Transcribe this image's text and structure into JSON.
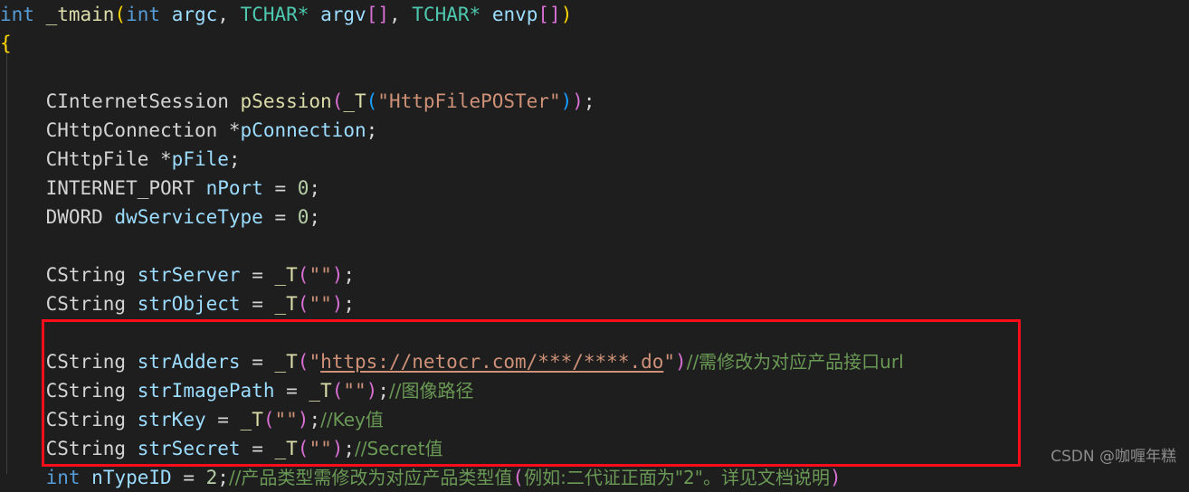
{
  "editor": {
    "background_color": "#1e1e1e",
    "default_text_color": "#d4d4d4",
    "language": "cpp",
    "font_size_px": 21,
    "line_height_px": 32
  },
  "highlight_box": {
    "color": "#fc0d1b",
    "covers_lines": [
      "CString strAdders = _T(\"https://netocr.com/***/****.do\")//需修改为对应产品接口url",
      "CString strImagePath = _T(\"\");//图像路径",
      "CString strKey = _T(\"\");//Key值",
      "CString strSecret = _T(\"\");//Secret值",
      "int nTypeID = 2;//产品类型需修改为对应产品类型值(例如:二代证正面为\"2\"。详见文档说明)"
    ]
  },
  "watermark": {
    "text": "CSDN @咖喱年糕",
    "color": "#8c8c8c"
  },
  "code_lines": [
    {
      "index": 1,
      "text": "int _tmain(int argc, TCHAR* argv[], TCHAR* envp[])",
      "tokens": [
        {
          "t": "int",
          "c": "c-keyword"
        },
        {
          "t": " ",
          "c": "c-plain"
        },
        {
          "t": "_tmain",
          "c": "c-func"
        },
        {
          "t": "(",
          "c": "c-brk-gold"
        },
        {
          "t": "int",
          "c": "c-keyword"
        },
        {
          "t": " ",
          "c": "c-plain"
        },
        {
          "t": "argc",
          "c": "c-var"
        },
        {
          "t": ", ",
          "c": "c-punc"
        },
        {
          "t": "TCHAR",
          "c": "c-type"
        },
        {
          "t": "*",
          "c": "c-type"
        },
        {
          "t": " ",
          "c": "c-plain"
        },
        {
          "t": "argv",
          "c": "c-var"
        },
        {
          "t": "[]",
          "c": "c-brk-pink"
        },
        {
          "t": ", ",
          "c": "c-punc"
        },
        {
          "t": "TCHAR",
          "c": "c-type"
        },
        {
          "t": "*",
          "c": "c-type"
        },
        {
          "t": " ",
          "c": "c-plain"
        },
        {
          "t": "envp",
          "c": "c-var"
        },
        {
          "t": "[]",
          "c": "c-brk-pink"
        },
        {
          "t": ")",
          "c": "c-brk-gold"
        }
      ]
    },
    {
      "index": 2,
      "text": "{",
      "tokens": [
        {
          "t": "{",
          "c": "c-brk-gold"
        }
      ]
    },
    {
      "index": 3,
      "text": "",
      "tokens": []
    },
    {
      "index": 4,
      "text": "    CInternetSession pSession(_T(\"HttpFilePOSTer\"));",
      "tokens": [
        {
          "t": "    ",
          "c": "c-plain"
        },
        {
          "t": "CInternetSession",
          "c": "c-plain"
        },
        {
          "t": " ",
          "c": "c-plain"
        },
        {
          "t": "pSession",
          "c": "c-func"
        },
        {
          "t": "(",
          "c": "c-brk-pink"
        },
        {
          "t": "_T",
          "c": "c-func"
        },
        {
          "t": "(",
          "c": "c-brk-blue"
        },
        {
          "t": "\"HttpFilePOSTer\"",
          "c": "c-string"
        },
        {
          "t": ")",
          "c": "c-brk-blue"
        },
        {
          "t": ")",
          "c": "c-brk-pink"
        },
        {
          "t": ";",
          "c": "c-punc"
        }
      ]
    },
    {
      "index": 5,
      "text": "    CHttpConnection *pConnection;",
      "tokens": [
        {
          "t": "    ",
          "c": "c-plain"
        },
        {
          "t": "CHttpConnection",
          "c": "c-plain"
        },
        {
          "t": " *",
          "c": "c-plain"
        },
        {
          "t": "pConnection",
          "c": "c-var"
        },
        {
          "t": ";",
          "c": "c-punc"
        }
      ]
    },
    {
      "index": 6,
      "text": "    CHttpFile *pFile;",
      "tokens": [
        {
          "t": "    ",
          "c": "c-plain"
        },
        {
          "t": "CHttpFile",
          "c": "c-plain"
        },
        {
          "t": " *",
          "c": "c-plain"
        },
        {
          "t": "pFile",
          "c": "c-var"
        },
        {
          "t": ";",
          "c": "c-punc"
        }
      ]
    },
    {
      "index": 7,
      "text": "    INTERNET_PORT nPort = 0;",
      "tokens": [
        {
          "t": "    ",
          "c": "c-plain"
        },
        {
          "t": "INTERNET_PORT",
          "c": "c-plain"
        },
        {
          "t": " ",
          "c": "c-plain"
        },
        {
          "t": "nPort",
          "c": "c-var"
        },
        {
          "t": " = ",
          "c": "c-punc"
        },
        {
          "t": "0",
          "c": "c-number"
        },
        {
          "t": ";",
          "c": "c-punc"
        }
      ]
    },
    {
      "index": 8,
      "text": "    DWORD dwServiceType = 0;",
      "tokens": [
        {
          "t": "    ",
          "c": "c-plain"
        },
        {
          "t": "DWORD",
          "c": "c-plain"
        },
        {
          "t": " ",
          "c": "c-plain"
        },
        {
          "t": "dwServiceType",
          "c": "c-var"
        },
        {
          "t": " = ",
          "c": "c-punc"
        },
        {
          "t": "0",
          "c": "c-number"
        },
        {
          "t": ";",
          "c": "c-punc"
        }
      ]
    },
    {
      "index": 9,
      "text": "",
      "tokens": []
    },
    {
      "index": 10,
      "text": "    CString strServer = _T(\"\");",
      "tokens": [
        {
          "t": "    ",
          "c": "c-plain"
        },
        {
          "t": "CString",
          "c": "c-plain"
        },
        {
          "t": " ",
          "c": "c-plain"
        },
        {
          "t": "strServer",
          "c": "c-var"
        },
        {
          "t": " = ",
          "c": "c-punc"
        },
        {
          "t": "_T",
          "c": "c-func"
        },
        {
          "t": "(",
          "c": "c-brk-pink"
        },
        {
          "t": "\"\"",
          "c": "c-string"
        },
        {
          "t": ")",
          "c": "c-brk-pink"
        },
        {
          "t": ";",
          "c": "c-punc"
        }
      ]
    },
    {
      "index": 11,
      "text": "    CString strObject = _T(\"\");",
      "tokens": [
        {
          "t": "    ",
          "c": "c-plain"
        },
        {
          "t": "CString",
          "c": "c-plain"
        },
        {
          "t": " ",
          "c": "c-plain"
        },
        {
          "t": "strObject",
          "c": "c-var"
        },
        {
          "t": " = ",
          "c": "c-punc"
        },
        {
          "t": "_T",
          "c": "c-func"
        },
        {
          "t": "(",
          "c": "c-brk-pink"
        },
        {
          "t": "\"\"",
          "c": "c-string"
        },
        {
          "t": ")",
          "c": "c-brk-pink"
        },
        {
          "t": ";",
          "c": "c-punc"
        }
      ]
    },
    {
      "index": 12,
      "text": "",
      "tokens": []
    },
    {
      "index": 13,
      "text": "    CString strAdders = _T(\"https://netocr.com/***/****.do\")//需修改为对应产品接口url",
      "tokens": [
        {
          "t": "    ",
          "c": "c-plain"
        },
        {
          "t": "CString",
          "c": "c-plain"
        },
        {
          "t": " ",
          "c": "c-plain"
        },
        {
          "t": "strAdders",
          "c": "c-var"
        },
        {
          "t": " = ",
          "c": "c-punc"
        },
        {
          "t": "_T",
          "c": "c-func"
        },
        {
          "t": "(",
          "c": "c-brk-pink"
        },
        {
          "t": "\"",
          "c": "c-string"
        },
        {
          "t": "https://netocr.com/***/****.do",
          "c": "c-string underlined"
        },
        {
          "t": "\"",
          "c": "c-string"
        },
        {
          "t": ")",
          "c": "c-brk-pink"
        },
        {
          "t": "//需修改为对应产品接口url",
          "c": "c-comment"
        }
      ]
    },
    {
      "index": 14,
      "text": "    CString strImagePath = _T(\"\");//图像路径",
      "tokens": [
        {
          "t": "    ",
          "c": "c-plain"
        },
        {
          "t": "CString",
          "c": "c-plain"
        },
        {
          "t": " ",
          "c": "c-plain"
        },
        {
          "t": "strImagePath",
          "c": "c-var"
        },
        {
          "t": " = ",
          "c": "c-punc"
        },
        {
          "t": "_T",
          "c": "c-func"
        },
        {
          "t": "(",
          "c": "c-brk-pink"
        },
        {
          "t": "\"\"",
          "c": "c-string"
        },
        {
          "t": ")",
          "c": "c-brk-pink"
        },
        {
          "t": ";",
          "c": "c-punc"
        },
        {
          "t": "//图像路径",
          "c": "c-comment"
        }
      ]
    },
    {
      "index": 15,
      "text": "    CString strKey = _T(\"\");//Key值",
      "tokens": [
        {
          "t": "    ",
          "c": "c-plain"
        },
        {
          "t": "CString",
          "c": "c-plain"
        },
        {
          "t": " ",
          "c": "c-plain"
        },
        {
          "t": "strKey",
          "c": "c-var"
        },
        {
          "t": " = ",
          "c": "c-punc"
        },
        {
          "t": "_T",
          "c": "c-func"
        },
        {
          "t": "(",
          "c": "c-brk-pink"
        },
        {
          "t": "\"\"",
          "c": "c-string"
        },
        {
          "t": ")",
          "c": "c-brk-pink"
        },
        {
          "t": ";",
          "c": "c-punc"
        },
        {
          "t": "//Key值",
          "c": "c-comment"
        }
      ]
    },
    {
      "index": 16,
      "text": "    CString strSecret = _T(\"\");//Secret值",
      "tokens": [
        {
          "t": "    ",
          "c": "c-plain"
        },
        {
          "t": "CString",
          "c": "c-plain"
        },
        {
          "t": " ",
          "c": "c-plain"
        },
        {
          "t": "strSecret",
          "c": "c-var"
        },
        {
          "t": " = ",
          "c": "c-punc"
        },
        {
          "t": "_T",
          "c": "c-func"
        },
        {
          "t": "(",
          "c": "c-brk-pink"
        },
        {
          "t": "\"\"",
          "c": "c-string"
        },
        {
          "t": ")",
          "c": "c-brk-pink"
        },
        {
          "t": ";",
          "c": "c-punc"
        },
        {
          "t": "//Secret值",
          "c": "c-comment"
        }
      ]
    },
    {
      "index": 17,
      "text": "    int nTypeID = 2;//产品类型需修改为对应产品类型值(例如:二代证正面为\"2\"。详见文档说明)",
      "tokens": [
        {
          "t": "    ",
          "c": "c-plain"
        },
        {
          "t": "int",
          "c": "c-keyword"
        },
        {
          "t": " ",
          "c": "c-plain"
        },
        {
          "t": "nTypeID",
          "c": "c-var"
        },
        {
          "t": " = ",
          "c": "c-punc"
        },
        {
          "t": "2",
          "c": "c-number"
        },
        {
          "t": ";",
          "c": "c-punc"
        },
        {
          "t": "//产品类型需修改为对应产品类型值",
          "c": "c-comment"
        },
        {
          "t": "(",
          "c": "c-brk-pink"
        },
        {
          "t": "例如:二代证正面为\"2\"。详见文档说明",
          "c": "c-comment"
        },
        {
          "t": ")",
          "c": "c-brk-pink"
        }
      ]
    }
  ]
}
